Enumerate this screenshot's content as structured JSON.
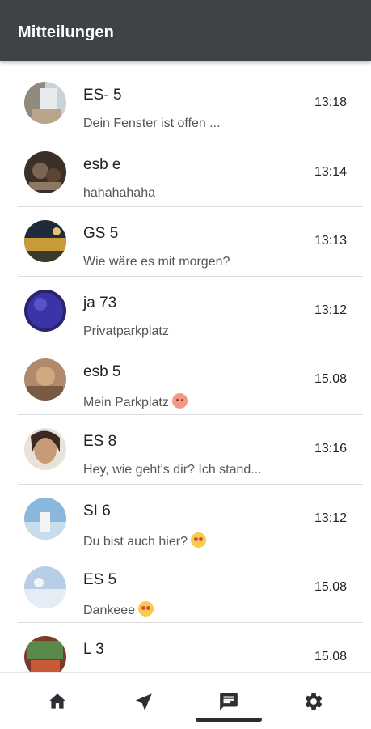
{
  "header": {
    "title": "Mitteilungen"
  },
  "messages": [
    {
      "name": "ES-     5",
      "preview": "Dein Fenster ist offen ...",
      "time": "13:18",
      "emoji": ""
    },
    {
      "name": "esb       e",
      "preview": "hahahahaha",
      "time": "13:14",
      "emoji": ""
    },
    {
      "name": "GS       5",
      "preview": "Wie wäre es mit morgen?",
      "time": "13:13",
      "emoji": ""
    },
    {
      "name": "ja      73",
      "preview": "Privatparkplatz",
      "time": "13:12",
      "emoji": ""
    },
    {
      "name": "esb      5",
      "preview": "Mein Parkplatz",
      "time": "15.08",
      "emoji": "angry-face"
    },
    {
      "name": "ES      8",
      "preview": "Hey, wie geht's dir? Ich stand...",
      "time": "13:16",
      "emoji": ""
    },
    {
      "name": "SI       6",
      "preview": "Du bist auch hier?",
      "time": "13:12",
      "emoji": "heart-eyes-face"
    },
    {
      "name": "ES       5",
      "preview": "Dankeee",
      "time": "15.08",
      "emoji": "heart-eyes-face"
    },
    {
      "name": "L     3",
      "preview": "",
      "time": "15.08",
      "emoji": ""
    }
  ],
  "nav": [
    {
      "icon": "home-icon",
      "active": false
    },
    {
      "icon": "navigation-arrow-icon",
      "active": false
    },
    {
      "icon": "chat-icon",
      "active": true
    },
    {
      "icon": "gear-icon",
      "active": false
    }
  ],
  "colors": {
    "app_bar": "#3f4347",
    "nav_icon": "#2b2f33"
  }
}
